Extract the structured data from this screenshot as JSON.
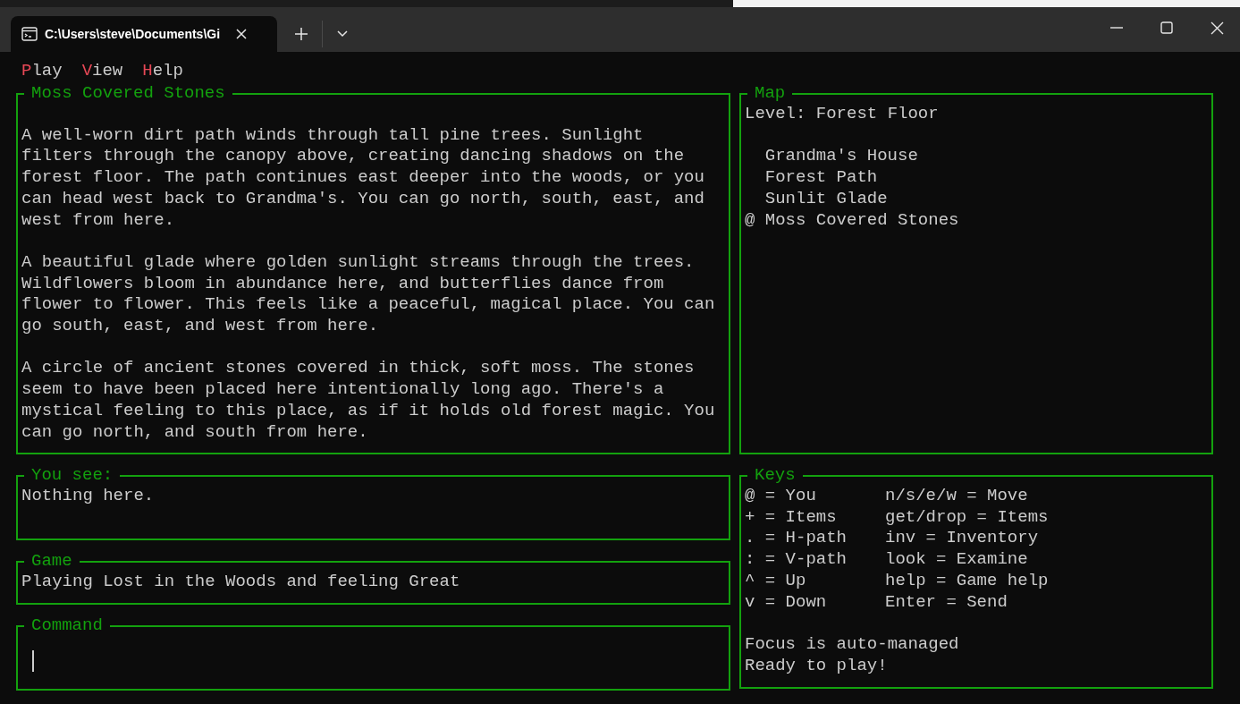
{
  "tab": {
    "title": "C:\\Users\\steve\\Documents\\Gi",
    "selected": true
  },
  "menu": [
    {
      "key": "P",
      "rest": "lay"
    },
    {
      "key": "V",
      "rest": "iew"
    },
    {
      "key": "H",
      "rest": "elp"
    }
  ],
  "room": {
    "title": "Moss Covered Stones",
    "paragraphs": [
      [
        "A well-worn dirt path winds through tall pine trees. Sunlight",
        "filters through the canopy above, creating dancing shadows on the",
        "forest floor. The path continues east deeper into the woods, or you",
        "can head west back to Grandma's. You can go north, south, east, and",
        "west from here."
      ],
      [
        "A beautiful glade where golden sunlight streams through the trees.",
        "Wildflowers bloom in abundance here, and butterflies dance from",
        "flower to flower. This feels like a peaceful, magical place. You can",
        "go south, east, and west from here."
      ],
      [
        "A circle of ancient stones covered in thick, soft moss. The stones",
        "seem to have been placed here intentionally long ago. There's a",
        "mystical feeling to this place, as if it holds old forest magic. You",
        "can go north, and south from here."
      ]
    ]
  },
  "map": {
    "title": "Map",
    "level": "Level: Forest Floor",
    "player_marker": "@",
    "rooms": [
      {
        "name": "Grandma's House",
        "here": false
      },
      {
        "name": "Forest Path",
        "here": false
      },
      {
        "name": "Sunlit Glade",
        "here": false
      },
      {
        "name": "Moss Covered Stones",
        "here": true
      }
    ]
  },
  "you_see": {
    "title": "You see:",
    "text": "Nothing here."
  },
  "game": {
    "title": "Game",
    "text": "Playing Lost in the Woods and feeling Great"
  },
  "command": {
    "title": "Command"
  },
  "keys": {
    "title": "Keys",
    "rows": [
      {
        "legend": "@ = You",
        "command": "n/s/e/w = Move"
      },
      {
        "legend": "+ = Items",
        "command": "get/drop = Items"
      },
      {
        "legend": ". = H-path",
        "command": "inv = Inventory"
      },
      {
        "legend": ": = V-path",
        "command": "look = Examine"
      },
      {
        "legend": "^ = Up",
        "command": "help = Game help"
      },
      {
        "legend": "v = Down",
        "command": "Enter = Send"
      }
    ],
    "status": [
      "Focus is auto-managed",
      "Ready to play!"
    ]
  }
}
